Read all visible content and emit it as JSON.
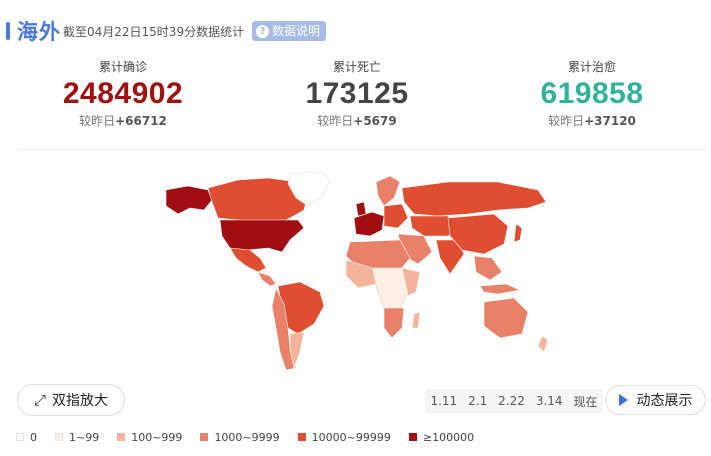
{
  "header": {
    "title": "海外",
    "subtitle": "截至04月22日15时39分数据统计",
    "info_button": "数据说明"
  },
  "stats": [
    {
      "label": "累计确诊",
      "value": "2484902",
      "delta_label": "较昨日",
      "delta": "+66712"
    },
    {
      "label": "累计死亡",
      "value": "173125",
      "delta_label": "较昨日",
      "delta": "+5679"
    },
    {
      "label": "累计治愈",
      "value": "619858",
      "delta_label": "较昨日",
      "delta": "+37120"
    }
  ],
  "controls": {
    "zoom_button": "双指放大",
    "timeline": [
      "1.11",
      "2.1",
      "2.22",
      "3.14",
      "现在"
    ],
    "play_button": "动态展示"
  },
  "legend": [
    {
      "label": "0",
      "color": "#ffffff"
    },
    {
      "label": "1~99",
      "color": "#fdeee6"
    },
    {
      "label": "100~999",
      "color": "#f6b39b"
    },
    {
      "label": "1000~9999",
      "color": "#e8806a"
    },
    {
      "label": "10000~99999",
      "color": "#e04e32"
    },
    {
      "label": "≥100000",
      "color": "#a00d12"
    }
  ],
  "colors": {
    "accent": "#4a79e0",
    "confirmed": "#a01111",
    "deaths": "#444444",
    "recovered": "#2fb39a"
  }
}
